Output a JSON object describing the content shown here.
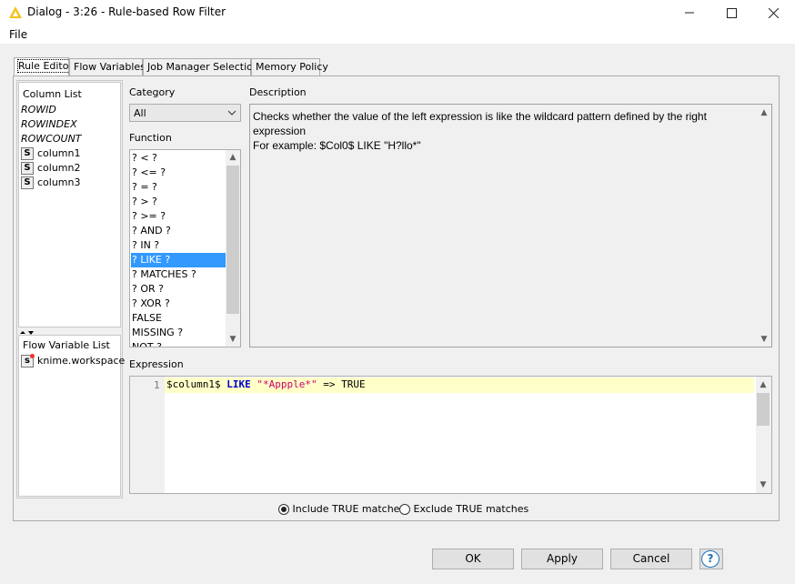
{
  "window": {
    "title": "Dialog - 3:26 - Rule-based Row Filter",
    "minimize": "—",
    "maximize": "☐",
    "close": "✕"
  },
  "menu": {
    "file": "File"
  },
  "tabs": [
    {
      "label": "Rule Editor",
      "active": true
    },
    {
      "label": "Flow Variables"
    },
    {
      "label": "Job Manager Selection"
    },
    {
      "label": "Memory Policy"
    }
  ],
  "column_list": {
    "header": "Column List",
    "items": [
      {
        "label": "ROWID",
        "type": "special"
      },
      {
        "label": "ROWINDEX",
        "type": "special"
      },
      {
        "label": "ROWCOUNT",
        "type": "special"
      },
      {
        "label": "column1",
        "type": "string",
        "icon": "S"
      },
      {
        "label": "column2",
        "type": "string",
        "icon": "S"
      },
      {
        "label": "column3",
        "type": "string",
        "icon": "S"
      }
    ]
  },
  "flow_variable_list": {
    "header": "Flow Variable List",
    "items": [
      {
        "label": "knime.workspace",
        "icon": "s"
      }
    ]
  },
  "category": {
    "label": "Category",
    "value": "All"
  },
  "function": {
    "label": "Function",
    "items": [
      "? < ?",
      "? <= ?",
      "? = ?",
      "? > ?",
      "? >= ?",
      "? AND ?",
      "? IN ?",
      "? LIKE ?",
      "? MATCHES ?",
      "? OR ?",
      "? XOR ?",
      "FALSE",
      "MISSING ?",
      "NOT ?"
    ],
    "selected": "? LIKE ?"
  },
  "description": {
    "label": "Description",
    "line1": "Checks whether the value of the left expression is like the wildcard pattern defined by the right",
    "line2": "expression",
    "line3": "For example: $Col0$ LIKE \"H?llo*\""
  },
  "expression": {
    "label": "Expression",
    "line_number": "1",
    "tokens": {
      "column": "$column1$",
      "keyword": "LIKE",
      "string": "\"*Appple*\"",
      "arrow": "=>",
      "result": "TRUE"
    }
  },
  "options": {
    "include": "Include TRUE matches",
    "exclude": "Exclude TRUE matches",
    "selected": "include"
  },
  "buttons": {
    "ok": "OK",
    "apply": "Apply",
    "cancel": "Cancel",
    "help": "?"
  },
  "colors": {
    "selection": "#3399ff",
    "keyword": "#0000cc",
    "string": "#cc0066",
    "current_line": "#ffffc8"
  }
}
